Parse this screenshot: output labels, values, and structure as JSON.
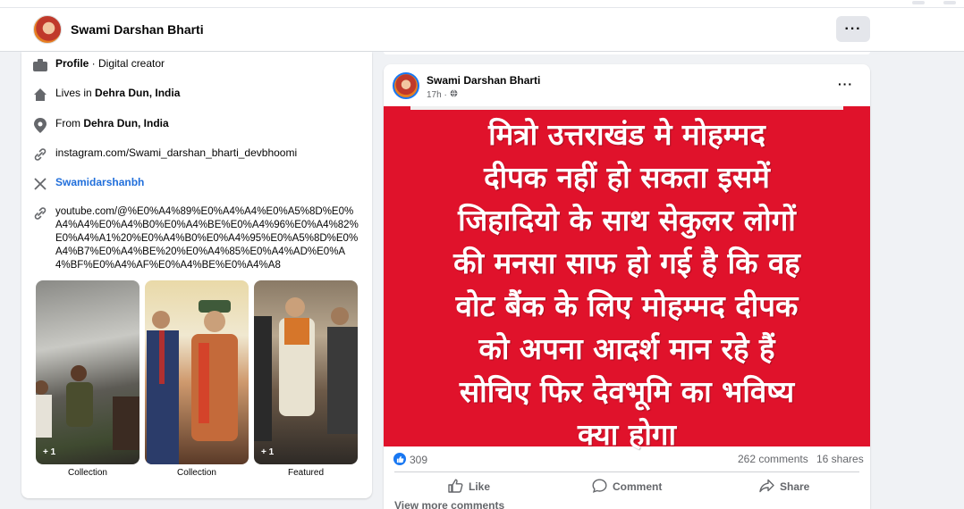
{
  "header": {
    "name": "Swami Darshan Bharti",
    "more_label": "···"
  },
  "intro": {
    "profile_label": "Profile",
    "profile_type": " · Digital creator",
    "lives_prefix": "Lives in ",
    "lives_city": "Dehra Dun, India",
    "from_prefix": "From ",
    "from_city": "Dehra Dun, India",
    "instagram": "instagram.com/Swami_darshan_bharti_devbhoomi",
    "x_handle": "Swamidarshanbh",
    "youtube": "youtube.com/@%E0%A4%89%E0%A4%A4%E0%A5%8D%E0%A4%A4%E0%A4%B0%E0%A4%BE%E0%A4%96%E0%A4%82%E0%A4%A1%20%E0%A4%B0%E0%A4%95%E0%A5%8D%E0%A4%B7%E0%A4%BE%20%E0%A4%85%E0%A4%AD%E0%A4%BF%E0%A4%AF%E0%A4%BE%E0%A4%A8",
    "photos": [
      {
        "label": "Collection",
        "extra": "+ 1"
      },
      {
        "label": "Collection",
        "extra": ""
      },
      {
        "label": "Featured",
        "extra": "+ 1"
      }
    ]
  },
  "post": {
    "author": "Swami Darshan Bharti",
    "time": "17h ·",
    "more_label": "···",
    "image_text_lines": [
      "मित्रो उत्तराखंड मे मोहम्मद",
      "दीपक नहीं हो सकता इसमें",
      "जिहादियो के साथ सेकुलर लोगों",
      "की मनसा साफ हो गई है कि वह",
      "वोट बैंक के लिए मोहम्मद दीपक",
      "को अपना आदर्श मान रहे हैं",
      "सोचिए फिर देवभूमि का भविष्य",
      "क्या होगा"
    ],
    "reactions": "309",
    "comments": "262 comments",
    "shares": "16 shares",
    "like_label": "Like",
    "comment_label": "Comment",
    "share_label": "Share",
    "view_more": "View more comments",
    "banner_color": "#e0122b"
  },
  "colors": {
    "accent": "#1877f2",
    "link": "#216fdb",
    "muted": "#65676b",
    "background": "#f0f2f5"
  }
}
